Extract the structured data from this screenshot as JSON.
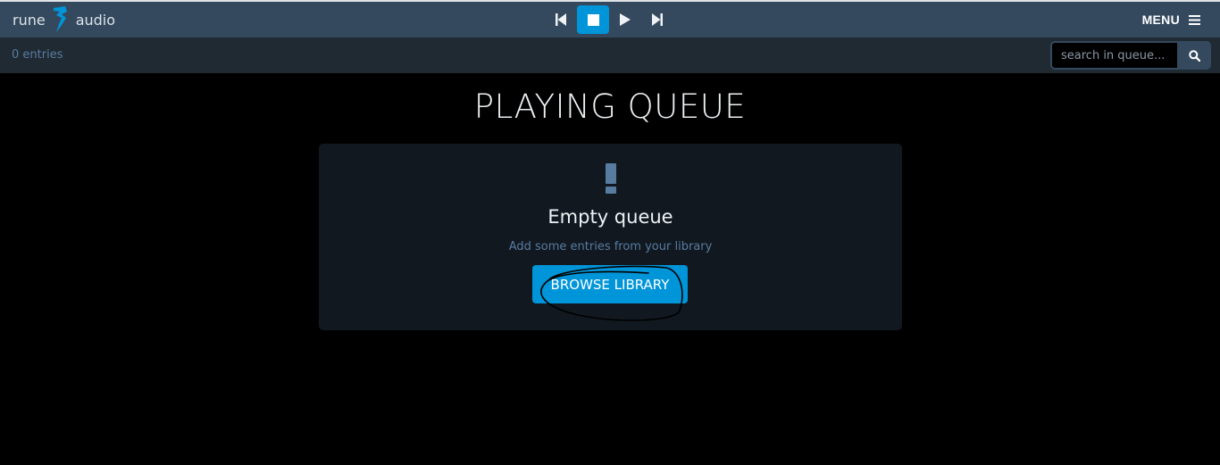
{
  "app": {
    "logo_left": "rune",
    "logo_right": "audio",
    "menu_label": "MENU"
  },
  "transport": {
    "icons": [
      "previous-icon",
      "stop-icon",
      "play-icon",
      "next-icon"
    ],
    "active": "stop"
  },
  "queue": {
    "entries_label": "0 entries",
    "search_placeholder": "search in queue..."
  },
  "main": {
    "title": "PLAYING QUEUE",
    "empty_title": "Empty queue",
    "empty_subtitle": "Add some entries from your library",
    "browse_label": "BROWSE LIBRARY"
  },
  "colors": {
    "accent": "#0095d8",
    "topbar": "#34495e",
    "subbar": "#202a33",
    "panel": "#111820",
    "muted_text": "#587ca0",
    "annotation": "#000000"
  }
}
